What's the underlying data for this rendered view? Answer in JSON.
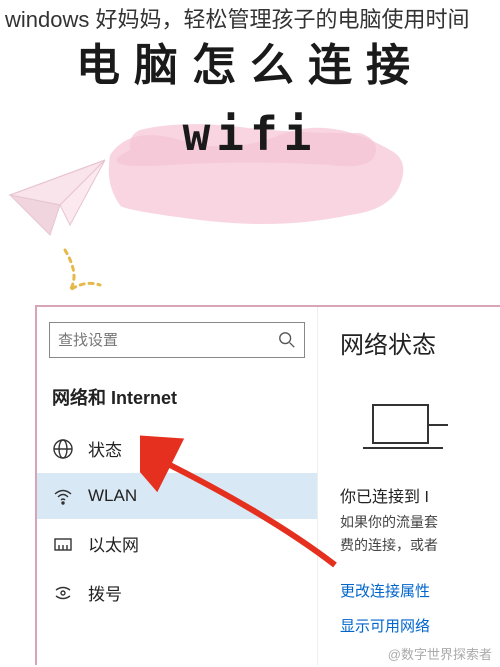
{
  "header": {
    "promo": "windows 好妈妈，轻松管理孩子的电脑使用时间"
  },
  "title": {
    "line1": "电脑怎么连接",
    "line2": "wifi"
  },
  "settings": {
    "search": {
      "placeholder": "查找设置"
    },
    "section_label": "网络和 Internet",
    "items": [
      {
        "icon": "globe",
        "label": "状态"
      },
      {
        "icon": "wifi",
        "label": "WLAN"
      },
      {
        "icon": "ethernet",
        "label": "以太网"
      },
      {
        "icon": "dialup",
        "label": "拨号"
      }
    ]
  },
  "status_panel": {
    "title": "网络状态",
    "connected_line": "你已连接到 I",
    "sub_line1": "如果你的流量套",
    "sub_line2": "费的连接，或者",
    "link1": "更改连接属性",
    "link2": "显示可用网络"
  },
  "watermark": "@数字世界探索者"
}
